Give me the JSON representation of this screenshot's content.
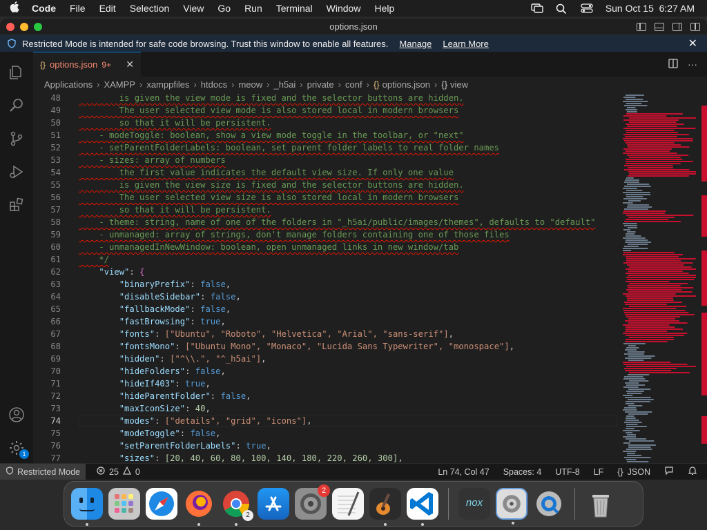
{
  "menubar": {
    "app": "Code",
    "items": [
      "File",
      "Edit",
      "Selection",
      "View",
      "Go",
      "Run",
      "Terminal",
      "Window",
      "Help"
    ],
    "clock": "Sun Oct 15  6:27 AM"
  },
  "window": {
    "title": "options.json"
  },
  "restricted_banner": {
    "message": "Restricted Mode is intended for safe code browsing. Trust this window to enable all features.",
    "manage": "Manage",
    "learn_more": "Learn More"
  },
  "tab": {
    "icon": "{}",
    "name": "options.json",
    "problems": "9+"
  },
  "breadcrumb": [
    "Applications",
    "XAMPP",
    "xamppfiles",
    "htdocs",
    "meow",
    "_h5ai",
    "private",
    "conf"
  ],
  "breadcrumb_file": "options.json",
  "breadcrumb_symbol": "view",
  "lines": [
    {
      "n": "48",
      "cls": "cm",
      "t": "        is given the view mode is fixed and the selector buttons are hidden."
    },
    {
      "n": "49",
      "cls": "cm",
      "t": "        The user selected view mode is also stored local in modern browsers"
    },
    {
      "n": "50",
      "cls": "cm",
      "t": "        so that it will be persistent."
    },
    {
      "n": "51",
      "cls": "cm",
      "t": "    - modeToggle: boolean, show a view mode toggle in the toolbar, or \"next\""
    },
    {
      "n": "52",
      "cls": "cm",
      "t": "    - setParentFolderLabels: boolean, set parent folder labels to real folder names"
    },
    {
      "n": "53",
      "cls": "cm",
      "t": "    - sizes: array of numbers"
    },
    {
      "n": "54",
      "cls": "cm",
      "t": "        the first value indicates the default view size. If only one value"
    },
    {
      "n": "55",
      "cls": "cm",
      "t": "        is given the view size is fixed and the selector buttons are hidden."
    },
    {
      "n": "56",
      "cls": "cm",
      "t": "        The user selected view size is also stored local in modern browsers"
    },
    {
      "n": "57",
      "cls": "cm",
      "t": "        so that it will be persistent."
    },
    {
      "n": "58",
      "cls": "cm",
      "t": "    - theme: string, name of one of the folders in \"_h5ai/public/images/themes\", defaults to \"default\""
    },
    {
      "n": "59",
      "cls": "cm",
      "t": "    - unmanaged: array of strings, don't manage folders containing one of those files"
    },
    {
      "n": "60",
      "cls": "cm",
      "t": "    - unmanagedInNewWindow: boolean, open unmanaged links in new window/tab"
    },
    {
      "n": "61",
      "cls": "cm",
      "t": "    */"
    }
  ],
  "json_lines": [
    {
      "n": "62",
      "indent": "    ",
      "key": "\"view\"",
      "val": "{",
      "vcls": "brk",
      "comma": ""
    },
    {
      "n": "63",
      "indent": "        ",
      "key": "\"binaryPrefix\"",
      "val": "false",
      "vcls": "kw",
      "comma": ","
    },
    {
      "n": "64",
      "indent": "        ",
      "key": "\"disableSidebar\"",
      "val": "false",
      "vcls": "kw",
      "comma": ","
    },
    {
      "n": "65",
      "indent": "        ",
      "key": "\"fallbackMode\"",
      "val": "false",
      "vcls": "kw",
      "comma": ","
    },
    {
      "n": "66",
      "indent": "        ",
      "key": "\"fastBrowsing\"",
      "val": "true",
      "vcls": "kw",
      "comma": ","
    },
    {
      "n": "67",
      "indent": "        ",
      "key": "\"fonts\"",
      "val": "[\"Ubuntu\", \"Roboto\", \"Helvetica\", \"Arial\", \"sans-serif\"]",
      "vcls": "str",
      "comma": ","
    },
    {
      "n": "68",
      "indent": "        ",
      "key": "\"fontsMono\"",
      "val": "[\"Ubuntu Mono\", \"Monaco\", \"Lucida Sans Typewriter\", \"monospace\"]",
      "vcls": "str",
      "comma": ","
    },
    {
      "n": "69",
      "indent": "        ",
      "key": "\"hidden\"",
      "val": "[\"^\\\\.\", \"^_h5ai\"]",
      "vcls": "str",
      "comma": ","
    },
    {
      "n": "70",
      "indent": "        ",
      "key": "\"hideFolders\"",
      "val": "false",
      "vcls": "kw",
      "comma": ","
    },
    {
      "n": "71",
      "indent": "        ",
      "key": "\"hideIf403\"",
      "val": "true",
      "vcls": "kw",
      "comma": ","
    },
    {
      "n": "72",
      "indent": "        ",
      "key": "\"hideParentFolder\"",
      "val": "false",
      "vcls": "kw",
      "comma": ","
    },
    {
      "n": "73",
      "indent": "        ",
      "key": "\"maxIconSize\"",
      "val": "40",
      "vcls": "num",
      "comma": ","
    },
    {
      "n": "74",
      "indent": "        ",
      "key": "\"modes\"",
      "val": "[\"details\", \"grid\", \"icons\"]",
      "vcls": "str",
      "comma": ","
    },
    {
      "n": "75",
      "indent": "        ",
      "key": "\"modeToggle\"",
      "val": "false",
      "vcls": "kw",
      "comma": ","
    },
    {
      "n": "76",
      "indent": "        ",
      "key": "\"setParentFolderLabels\"",
      "val": "true",
      "vcls": "kw",
      "comma": ","
    },
    {
      "n": "77",
      "indent": "        ",
      "key": "\"sizes\"",
      "val": "[20, 40, 60, 80, 100, 140, 180, 220, 260, 300]",
      "vcls": "num",
      "comma": ","
    }
  ],
  "current_line": "74",
  "statusbar": {
    "restricted": "Restricted Mode",
    "errors": "25",
    "warnings": "0",
    "position": "Ln 74, Col 47",
    "spaces": "Spaces: 4",
    "encoding": "UTF-8",
    "eol": "LF",
    "language": "JSON"
  },
  "activity_badge": "1",
  "dock": {
    "settings_badge": "2",
    "chrome_badge": "2",
    "nox_label": "nox"
  },
  "colors": {
    "accent": "#0078d4",
    "error_red": "#e51400",
    "comment_green": "#6a9955"
  }
}
